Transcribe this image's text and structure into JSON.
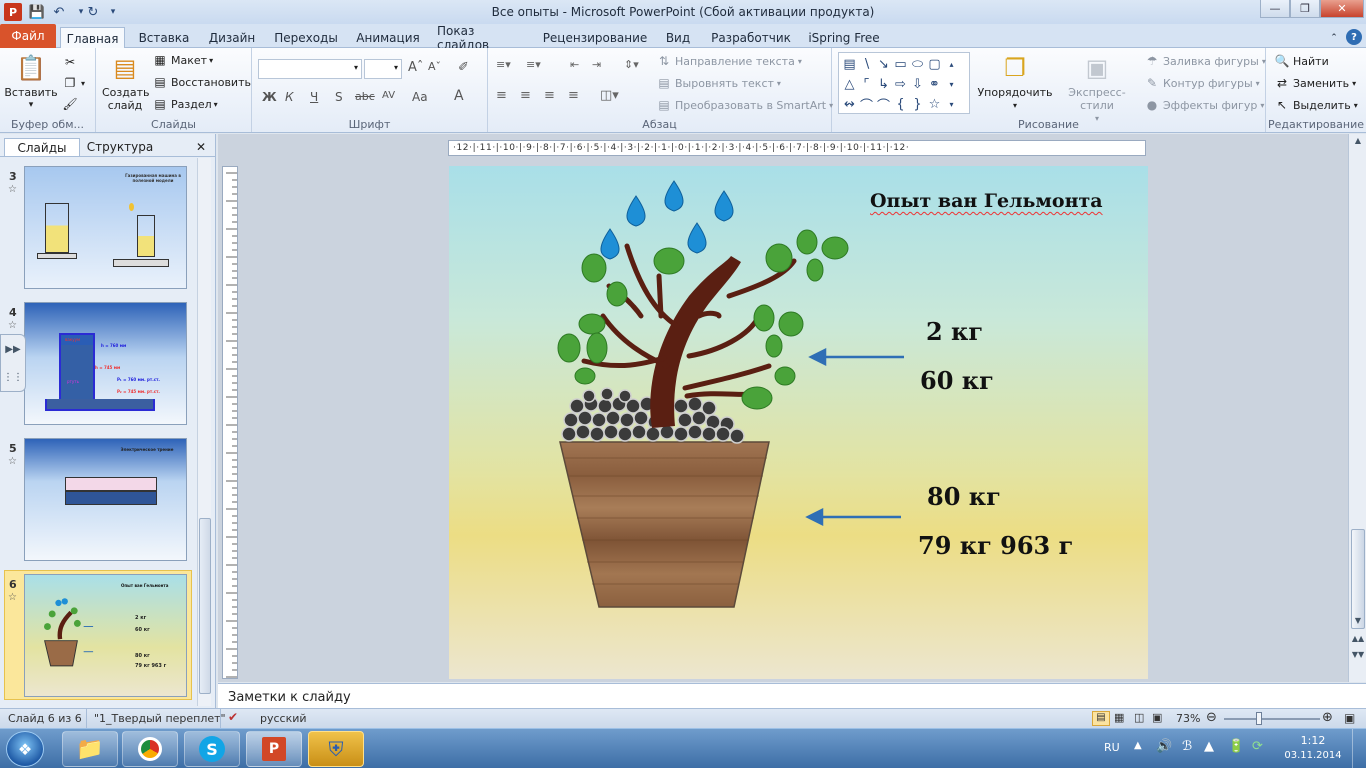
{
  "window": {
    "title": "Все опыты  -  Microsoft PowerPoint (Сбой активации продукта)"
  },
  "tabs": [
    {
      "label": "Файл"
    },
    {
      "label": "Главная"
    },
    {
      "label": "Вставка"
    },
    {
      "label": "Дизайн"
    },
    {
      "label": "Переходы"
    },
    {
      "label": "Анимация"
    },
    {
      "label": "Показ слайдов"
    },
    {
      "label": "Рецензирование"
    },
    {
      "label": "Вид"
    },
    {
      "label": "Разработчик"
    },
    {
      "label": "iSpring Free"
    }
  ],
  "ribbon": {
    "clipboard": {
      "group": "Буфер обм...",
      "paste": "Вставить"
    },
    "slides": {
      "group": "Слайды",
      "new_slide": "Создать слайд",
      "layout": "Макет",
      "reset": "Восстановить",
      "section": "Раздел"
    },
    "font": {
      "group": "Шрифт",
      "bold": "Ж",
      "italic": "К",
      "underline": "Ч",
      "shadow": "S",
      "strike": "abc",
      "spacing": "AV",
      "case": "Aa",
      "color": "A"
    },
    "paragraph": {
      "group": "Абзац",
      "text_direction": "Направление текста",
      "align_text": "Выровнять текст",
      "smartart": "Преобразовать в SmartArt"
    },
    "drawing": {
      "group": "Рисование",
      "arrange": "Упорядочить",
      "quick_styles": "Экспресс-стили",
      "fill": "Заливка фигуры",
      "outline": "Контур фигуры",
      "effects": "Эффекты фигур"
    },
    "editing": {
      "group": "Редактирование",
      "find": "Найти",
      "replace": "Заменить",
      "select": "Выделить"
    }
  },
  "panel": {
    "tab_slides": "Слайды",
    "tab_outline": "Структура",
    "thumbnails": [
      {
        "num": "3",
        "title": "Газированная машина в полезной модели"
      },
      {
        "num": "4",
        "labels": [
          "вакуум",
          "h = 760 мм",
          "h = 745 мм",
          "ртуть",
          "P₁ = 760 мм. рт.ст.",
          "P₂ = 745 мм. рт.ст."
        ]
      },
      {
        "num": "5",
        "title": "Электрическое трение"
      },
      {
        "num": "6",
        "title": "Опыт ван Гельмонта",
        "t1": "2 кг",
        "t2": "60 кг",
        "t3": "80 кг",
        "t4": "79 кг 963 г"
      }
    ]
  },
  "ruler": {
    "h": "·12·|·11·|·10·|·9·|·8·|·7·|·6·|·5·|·4·|·3·|·2·|·1·|·0·|·1·|·2·|·3·|·4·|·5·|·6·|·7·|·8·|·9·|·10·|·11·|·12·"
  },
  "slide": {
    "title": "Опыт ван Гельмонта",
    "label1": "2 кг",
    "label2": "60 кг",
    "label3": "80 кг",
    "label4": "79 кг 963 г",
    "colors": {
      "leaf": "#4aa33a",
      "trunk": "#5a1f12",
      "drop": "#1e8fd6",
      "arrow": "#2f6fb5",
      "pot": "#9a6b47"
    }
  },
  "notes": {
    "placeholder": "Заметки к слайду"
  },
  "status": {
    "slide_of": "Слайд 6 из 6",
    "theme": "\"1_Твердый переплет\"",
    "language": "русский",
    "zoom": "73%"
  },
  "taskbar": {
    "lang": "RU",
    "time": "1:12",
    "date": "03.11.2014"
  }
}
